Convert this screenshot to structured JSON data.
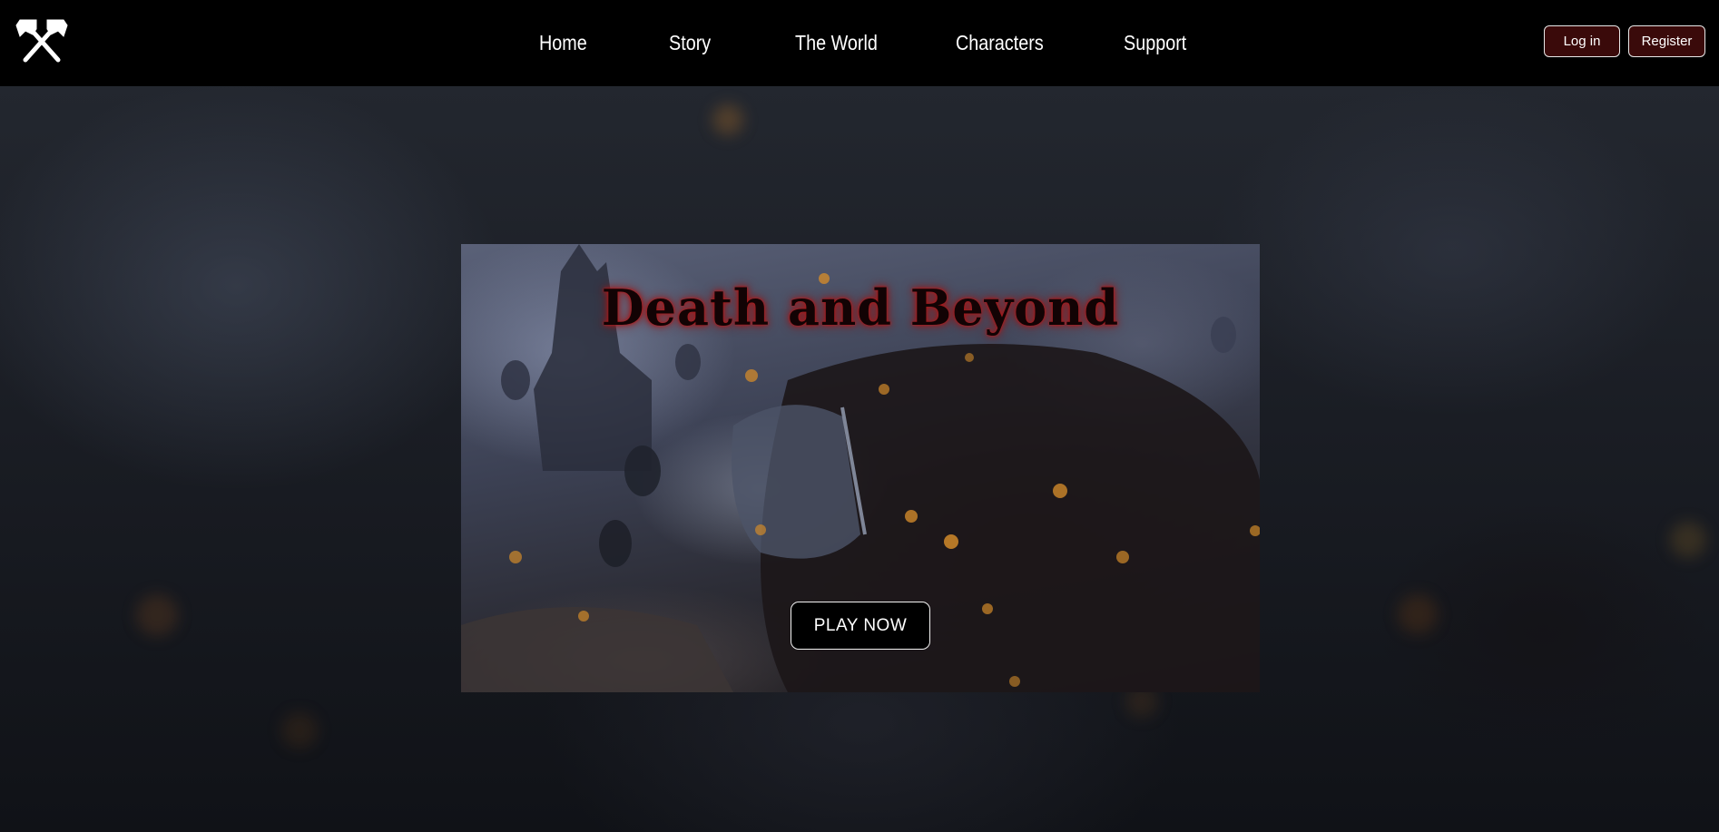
{
  "header": {
    "logo_icon": "crossed-hammers-icon",
    "nav": [
      {
        "label": "Home"
      },
      {
        "label": "Story"
      },
      {
        "label": "The World"
      },
      {
        "label": "Characters"
      },
      {
        "label": "Support"
      }
    ],
    "login_label": "Log in",
    "register_label": "Register",
    "auth_button_color": "#3a0a0a"
  },
  "hero": {
    "title": "Death and Beyond",
    "title_glow_color": "#b01818",
    "cta_label": "PLAY NOW"
  }
}
